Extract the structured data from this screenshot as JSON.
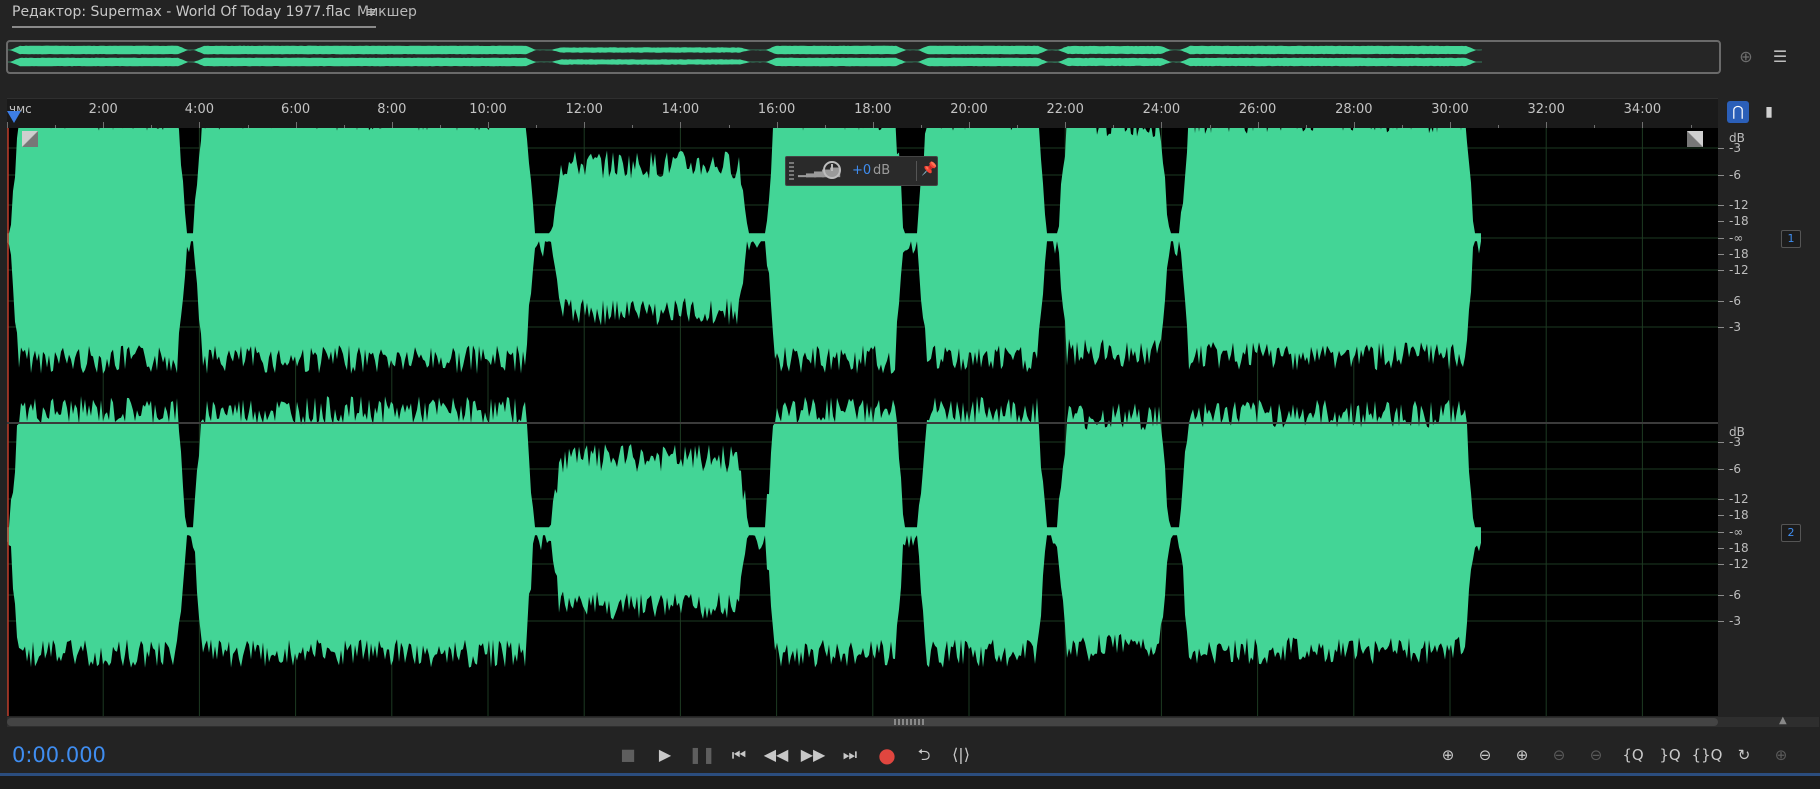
{
  "tabs": {
    "editor_label": "Редактор: Supermax - World Of Today 1977.flac",
    "editor_menu_icon": "≡",
    "mixer_label": "Микшер"
  },
  "overview": {
    "zoom_icon": "zoom-to-selection-icon",
    "list_icon": "list-icon"
  },
  "ruler": {
    "unit": "чмс",
    "ticks": [
      "2:00",
      "4:00",
      "6:00",
      "8:00",
      "10:00",
      "12:00",
      "14:00",
      "16:00",
      "18:00",
      "20:00",
      "22:00",
      "24:00",
      "26:00",
      "28:00",
      "30:00",
      "32:00",
      "34:00"
    ]
  },
  "hud": {
    "value": "+0",
    "unit": "dB"
  },
  "db_scale": {
    "unit": "dB",
    "labels": [
      "-3",
      "-6",
      "-12",
      "-18",
      "-∞",
      "-18",
      "-12",
      "-6",
      "-3"
    ]
  },
  "channels": [
    {
      "number": "1"
    },
    {
      "number": "2"
    }
  ],
  "transport": {
    "timecode": "0:00.000",
    "buttons": [
      "stop",
      "play",
      "pause",
      "go-to-start",
      "rewind",
      "fast-forward",
      "go-to-end",
      "record",
      "loop",
      "skip-selection"
    ]
  },
  "colors": {
    "waveform": "#43d596",
    "accent": "#3f8df0",
    "record": "#e0463f",
    "background": "#000000"
  }
}
